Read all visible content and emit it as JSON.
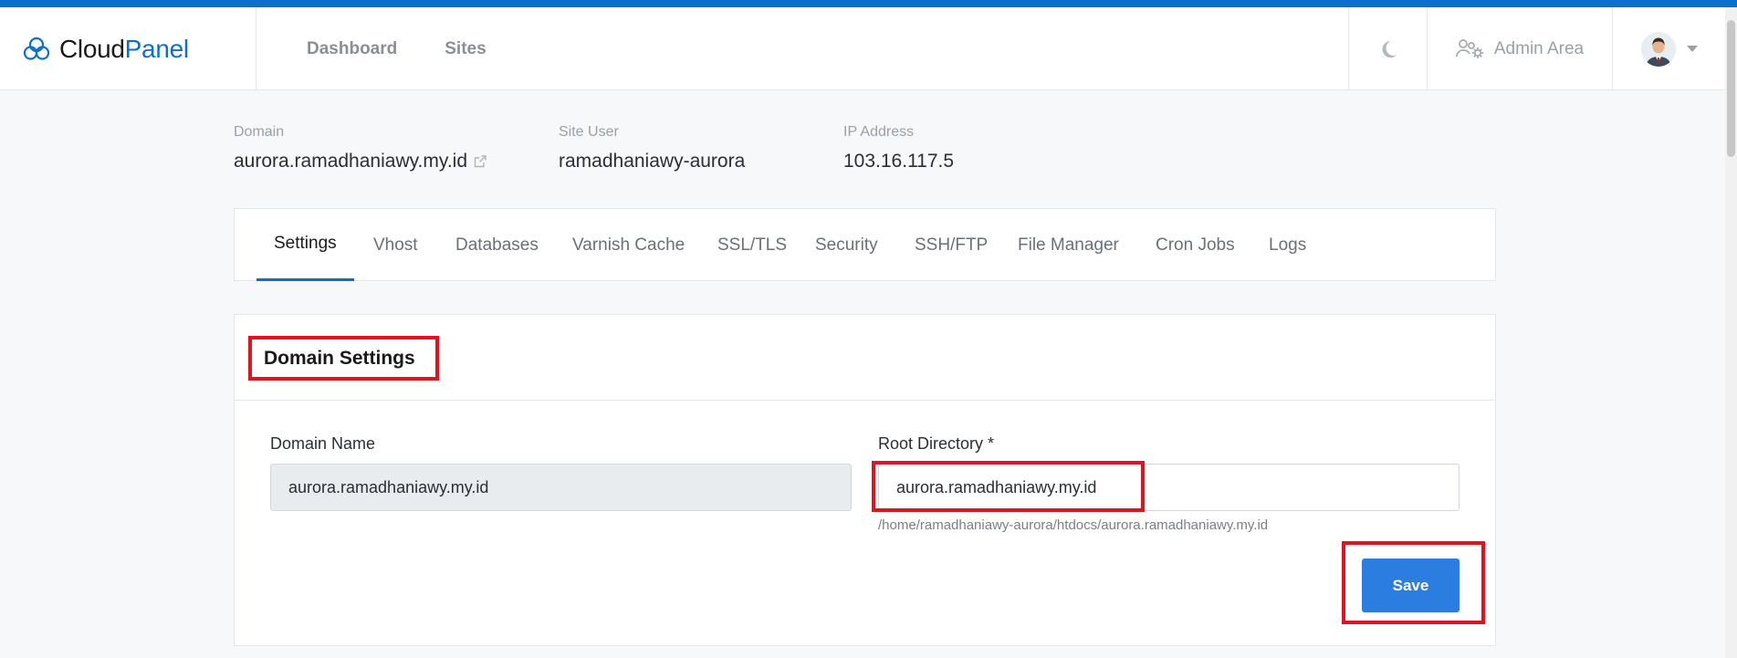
{
  "brand": {
    "name_part1": "Cloud",
    "name_part2": "Panel"
  },
  "nav": {
    "dashboard": "Dashboard",
    "sites": "Sites"
  },
  "header": {
    "admin_area": "Admin Area"
  },
  "site_info": {
    "domain_label": "Domain",
    "domain_value": "aurora.ramadhaniawy.my.id",
    "site_user_label": "Site User",
    "site_user_value": "ramadhaniawy-aurora",
    "ip_label": "IP Address",
    "ip_value": "103.16.117.5"
  },
  "tabs": [
    {
      "label": "Settings",
      "active": true
    },
    {
      "label": "Vhost"
    },
    {
      "label": "Databases"
    },
    {
      "label": "Varnish Cache"
    },
    {
      "label": "SSL/TLS"
    },
    {
      "label": "Security"
    },
    {
      "label": "SSH/FTP"
    },
    {
      "label": "File Manager"
    },
    {
      "label": "Cron Jobs"
    },
    {
      "label": "Logs"
    }
  ],
  "domain_settings": {
    "title": "Domain Settings",
    "domain_name_label": "Domain Name",
    "domain_name_value": "aurora.ramadhaniawy.my.id",
    "root_dir_label": "Root Directory *",
    "root_dir_value": "aurora.ramadhaniawy.my.id",
    "root_dir_hint": "/home/ramadhaniawy-aurora/htdocs/aurora.ramadhaniawy.my.id",
    "save_label": "Save"
  },
  "colors": {
    "accent": "#0b6fd0",
    "button": "#2b7de0",
    "highlight": "#e0141e"
  }
}
